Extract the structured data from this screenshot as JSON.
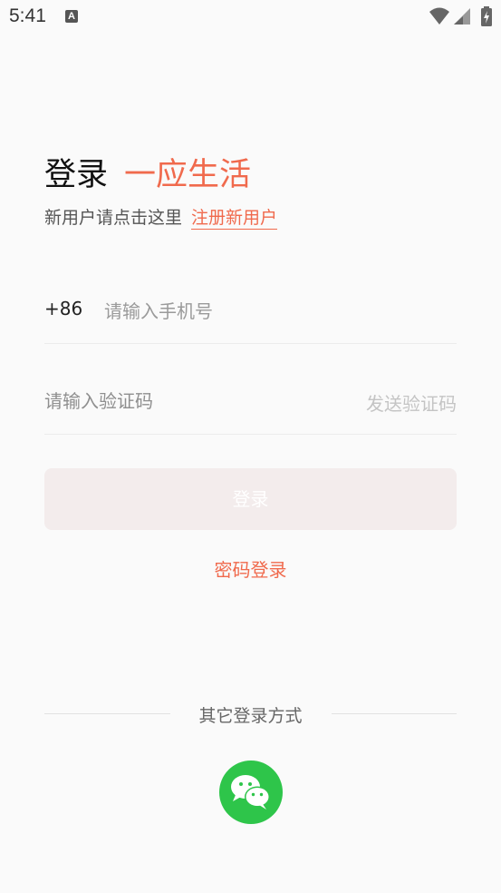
{
  "status_bar": {
    "time": "5:41",
    "notification_icon": "text-a-icon",
    "wifi_icon": "wifi-icon",
    "signal_icon": "cell-signal-icon",
    "battery_icon": "battery-charging-icon"
  },
  "header": {
    "login_title": "登录",
    "brand": "一应生活",
    "new_user_prompt": "新用户请点击这里",
    "register_link": "注册新用户"
  },
  "form": {
    "country_code": "+86",
    "phone_placeholder": "请输入手机号",
    "code_placeholder": "请输入验证码",
    "send_code_label": "发送验证码",
    "login_button_label": "登录",
    "password_login_label": "密码登录"
  },
  "other_login": {
    "label": "其它登录方式",
    "wechat_icon": "wechat-icon"
  },
  "colors": {
    "brand_accent": "#f06a4d",
    "wechat_green": "#2ec54a",
    "disabled_button_bg": "#f3ecec"
  }
}
